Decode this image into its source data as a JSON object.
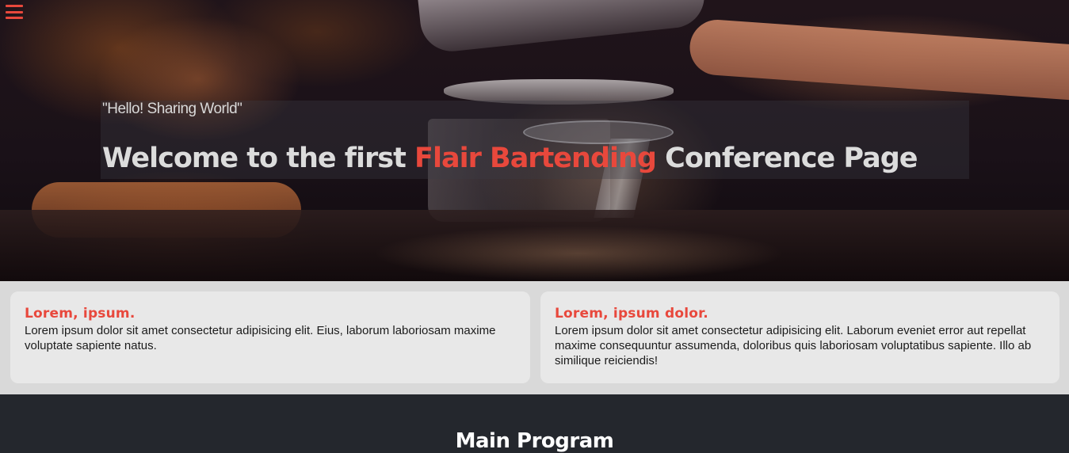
{
  "nav": {
    "menu_icon": "hamburger-menu-icon",
    "menu_color": "#e8483c"
  },
  "hero": {
    "quote": "\"Hello! Sharing World\"",
    "heading_before": "Welcome to the first ",
    "heading_accent": "Flair Bartending",
    "heading_after": " Conference Page",
    "accent_color": "#e8483c"
  },
  "cards": [
    {
      "title": "Lorem, ipsum.",
      "text": "Lorem ipsum dolor sit amet consectetur adipisicing elit. Eius, laborum laboriosam maxime voluptate sapiente natus."
    },
    {
      "title": "Lorem, ipsum dolor.",
      "text": "Lorem ipsum dolor sit amet consectetur adipisicing elit. Laborum eveniet error aut repellat maxime consequuntur assumenda, doloribus quis laboriosam voluptatibus sapiente. Illo ab similique reiciendis!"
    }
  ],
  "program": {
    "title": "Main Program"
  }
}
